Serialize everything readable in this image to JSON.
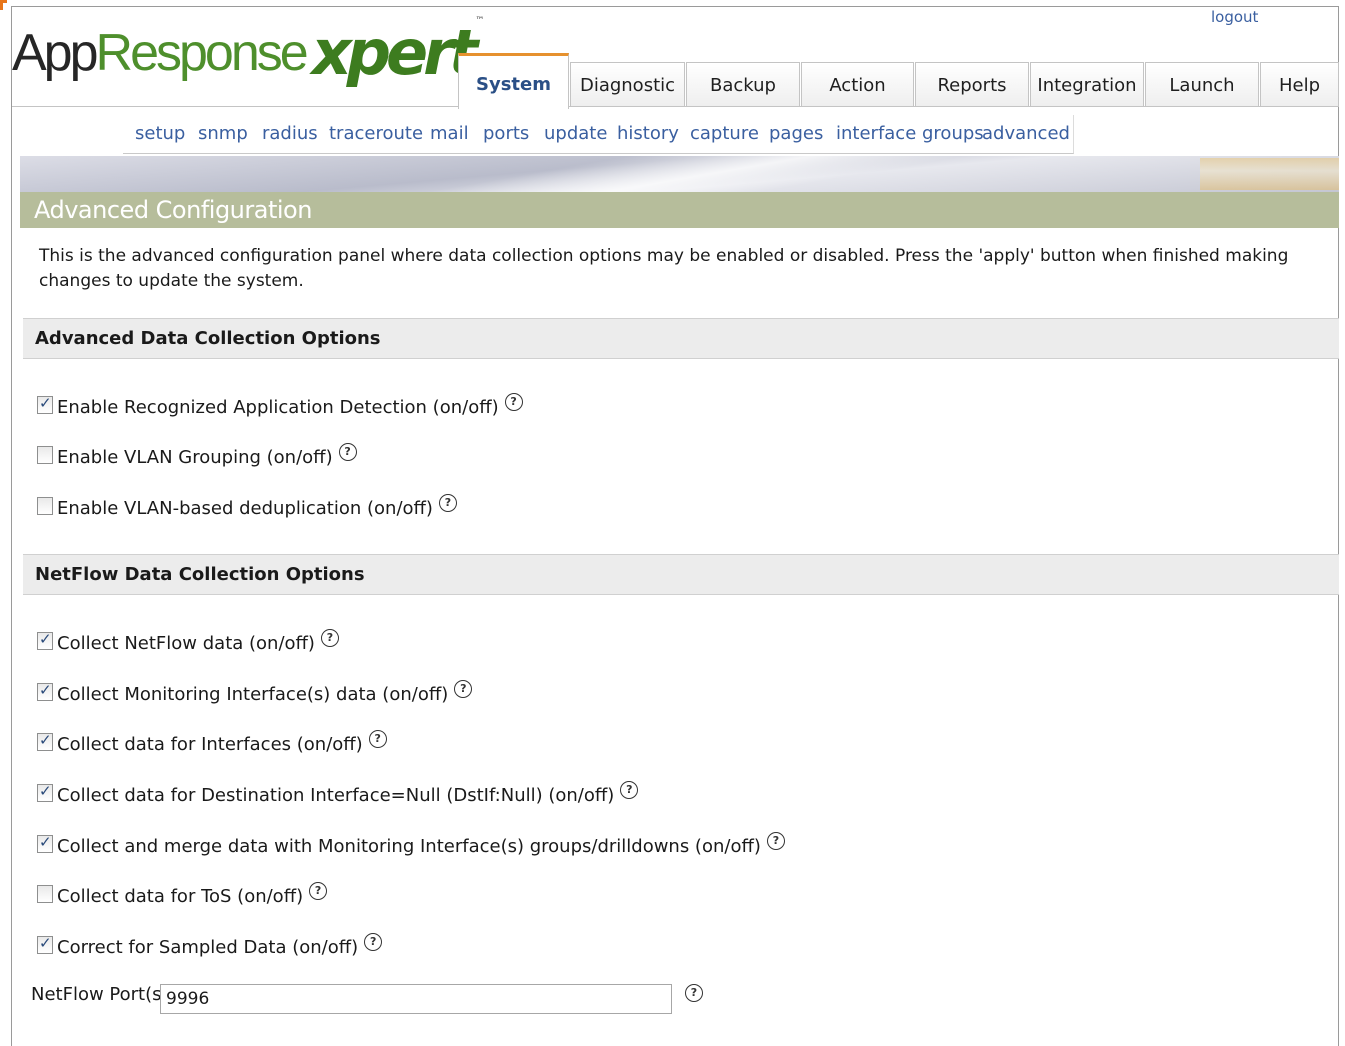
{
  "logo": {
    "part1": "App",
    "part2": "Response",
    "part3": "xpert",
    "tm": "™"
  },
  "logout": "logout",
  "tabs": [
    {
      "label": "System",
      "active": true
    },
    {
      "label": "Diagnostic"
    },
    {
      "label": "Backup"
    },
    {
      "label": "Action"
    },
    {
      "label": "Reports"
    },
    {
      "label": "Integration"
    },
    {
      "label": "Launch"
    },
    {
      "label": "Help"
    }
  ],
  "subnav": [
    "setup",
    "snmp",
    "radius",
    "traceroute",
    "mail",
    "ports",
    "update",
    "history",
    "capture",
    "pages",
    "interface groups",
    "advanced"
  ],
  "page_title": "Advanced Configuration",
  "intro": "This is the advanced configuration panel where data collection options may be enabled or disabled. Press the 'apply' button when finished making changes to update the system.",
  "sections": [
    {
      "title": "Advanced Data Collection Options",
      "options": [
        {
          "label": "Enable Recognized Application Detection (on/off)",
          "checked": true
        },
        {
          "label": "Enable VLAN Grouping (on/off)",
          "checked": false
        },
        {
          "label": "Enable VLAN-based deduplication (on/off)",
          "checked": false
        }
      ]
    },
    {
      "title": "NetFlow Data Collection Options",
      "options": [
        {
          "label": "Collect NetFlow data (on/off)",
          "checked": true
        },
        {
          "label": "Collect Monitoring Interface(s) data (on/off)",
          "checked": true
        },
        {
          "label": "Collect data for Interfaces (on/off)",
          "checked": true
        },
        {
          "label": "Collect data for Destination Interface=Null (DstIf:Null) (on/off)",
          "checked": true
        },
        {
          "label": "Collect and merge data with Monitoring Interface(s) groups/drilldowns (on/off)",
          "checked": true
        },
        {
          "label": "Collect data for ToS (on/off)",
          "checked": false
        },
        {
          "label": "Correct for Sampled Data (on/off)",
          "checked": true
        }
      ]
    }
  ],
  "netflow_port": {
    "label": "NetFlow Port(s):",
    "value": "9996"
  },
  "help_glyph": "?"
}
